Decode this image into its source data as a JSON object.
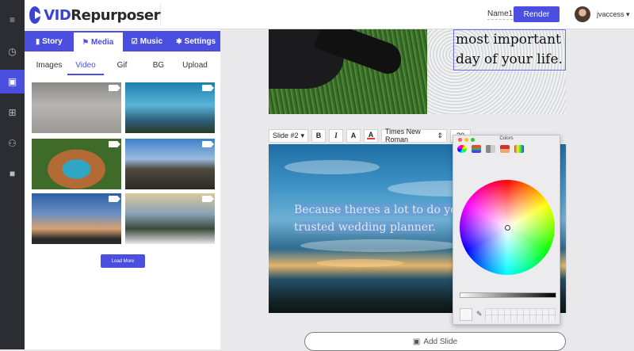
{
  "app": {
    "logo_vid": "VID",
    "logo_rest": "Repurposer"
  },
  "header": {
    "project_name": "Name1",
    "render_label": "Render",
    "username": "jvaccess ▾"
  },
  "rail": {
    "items": [
      {
        "icon": "menu-icon",
        "glyph": "≡"
      },
      {
        "icon": "history-icon",
        "glyph": "◷"
      },
      {
        "icon": "media-library-icon",
        "glyph": "▣"
      },
      {
        "icon": "table-icon",
        "glyph": "⊞"
      },
      {
        "icon": "users-icon",
        "glyph": "⚇"
      },
      {
        "icon": "video-camera-icon",
        "glyph": "■"
      }
    ]
  },
  "panel": {
    "tabs": [
      {
        "label": "Story",
        "icon": "book-icon",
        "glyph": "▮"
      },
      {
        "label": "Media",
        "icon": "flag-icon",
        "glyph": "⚑"
      },
      {
        "label": "Music",
        "icon": "music-icon",
        "glyph": "☑"
      },
      {
        "label": "Settings",
        "icon": "gear-icon",
        "glyph": "✱"
      }
    ],
    "subtabs": [
      "Images",
      "Video",
      "Gif",
      "BG",
      "Upload"
    ],
    "load_more": "Load More"
  },
  "editor": {
    "slide1_text": "most important day of your life.",
    "slide_select": "Slide #2",
    "bold": "B",
    "italic": "I",
    "text_a": "A",
    "color_a": "A",
    "font": "Times New Roman",
    "size": "20",
    "slide2_text": "Because theres a lot to do you trusted wedding planner.",
    "add_slide": "Add Slide"
  },
  "colors_panel": {
    "title": "Colors"
  },
  "theme": {
    "accent": "#4b4fe0",
    "rail": "#2b2d33"
  }
}
